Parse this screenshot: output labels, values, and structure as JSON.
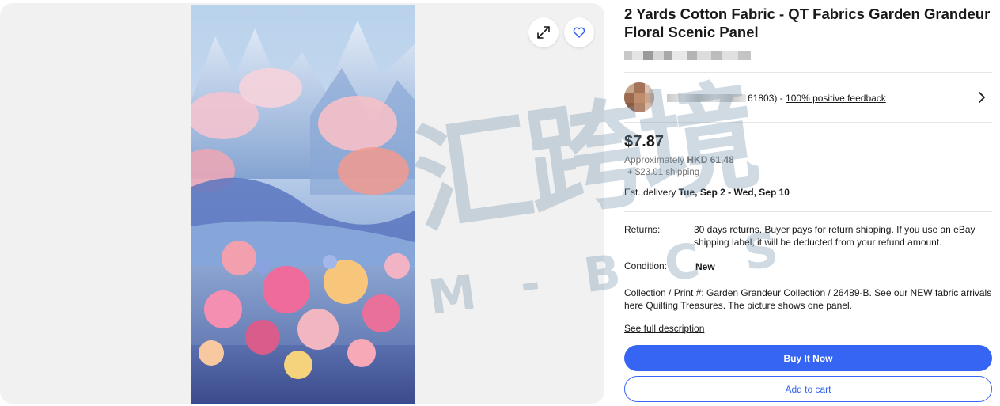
{
  "product": {
    "title": "2 Yards Cotton Fabric - QT Fabrics Garden Grandeur Floral Scenic Panel"
  },
  "seller": {
    "feedback_count_suffix": "61803)",
    "separator": " - ",
    "feedback_link": "100% positive feedback"
  },
  "pricing": {
    "price": "$7.87",
    "approx_prefix": "Approximately ",
    "approx_value": "HKD 61.48",
    "shipping": "+ $23.01 shipping",
    "delivery_prefix": "Est. delivery ",
    "delivery_dates": "Tue, Sep 2 - Wed, Sep 10"
  },
  "details": {
    "returns_label": "Returns:",
    "returns_value": "30 days returns. Buyer pays for return shipping. If you use an eBay shipping label, it will be deducted from your refund amount.",
    "condition_label": "Condition:",
    "condition_value": "New"
  },
  "description": {
    "text": "Collection / Print #: Garden Grandeur Collection / 26489-B. See our NEW fabric arrivals here Quilting Treasures. The picture shows one panel.",
    "see_full": "See full description"
  },
  "actions": {
    "buy_now": "Buy It Now",
    "add_to_cart": "Add to cart"
  },
  "icons": {
    "expand": "expand-icon",
    "favorite": "heart-icon",
    "chevron": "chevron-right-icon"
  },
  "watermark": {
    "main": "汇跨境",
    "sub": "M - B C S"
  },
  "colors": {
    "accent": "#3665f3",
    "text": "#191919",
    "muted": "#707070"
  }
}
